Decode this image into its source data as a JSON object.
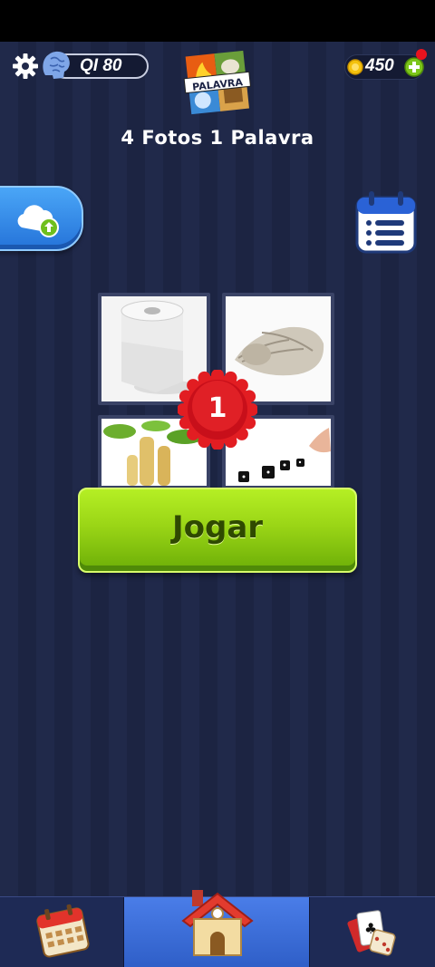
{
  "header": {
    "iq_label": "QI 80",
    "coins": "450",
    "title": "4 Fotos 1 Palavra",
    "logo_text": "PALAVRA"
  },
  "puzzle": {
    "level": "1",
    "images": [
      "toilet-paper-roll",
      "rolled-newspaper",
      "bamboo-shoots",
      "rolling-dice"
    ]
  },
  "play_button": {
    "label": "Jogar"
  },
  "icons": {
    "settings": "gear-icon",
    "iq": "brain-icon",
    "coins": "coin-icon",
    "add_coins": "plus-icon",
    "cloud_backup": "cloud-upload-icon",
    "daily": "calendar-icon",
    "nav_calendar": "calendar-icon",
    "nav_home": "house-icon",
    "nav_games": "cards-dice-icon"
  },
  "colors": {
    "background": "#20294a",
    "play_button": "#9ad516",
    "badge": "#d8101d",
    "nav_selected": "#3d6fdc"
  },
  "nav": {
    "selected": "home"
  }
}
